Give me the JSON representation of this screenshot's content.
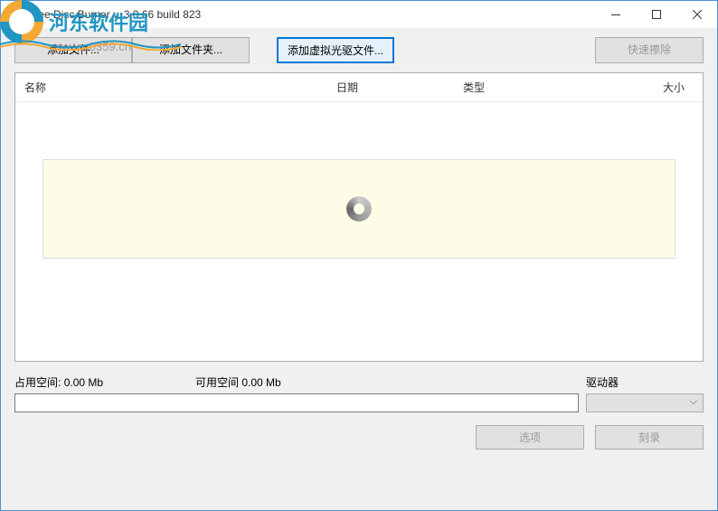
{
  "titlebar": {
    "title": "Free Disc Burner   v. 3.0.66 build 823"
  },
  "toolbar": {
    "add_file": "添加文件...",
    "add_folder": "添加文件夹...",
    "add_iso": "添加虚拟光驱文件...",
    "quick_erase": "快速擦除"
  },
  "columns": {
    "name": "名称",
    "date": "日期",
    "type": "类型",
    "size": "大小"
  },
  "status": {
    "used_label": "占用空间:",
    "used_value": "0.00 Mb",
    "free_label": "可用空间",
    "free_value": "0.00 Mb",
    "drive_label": "驱动器"
  },
  "buttons": {
    "options": "选项",
    "burn": "刻录"
  },
  "watermark": {
    "site_name": "河东软件园",
    "url": "www.pc0359.cn"
  }
}
